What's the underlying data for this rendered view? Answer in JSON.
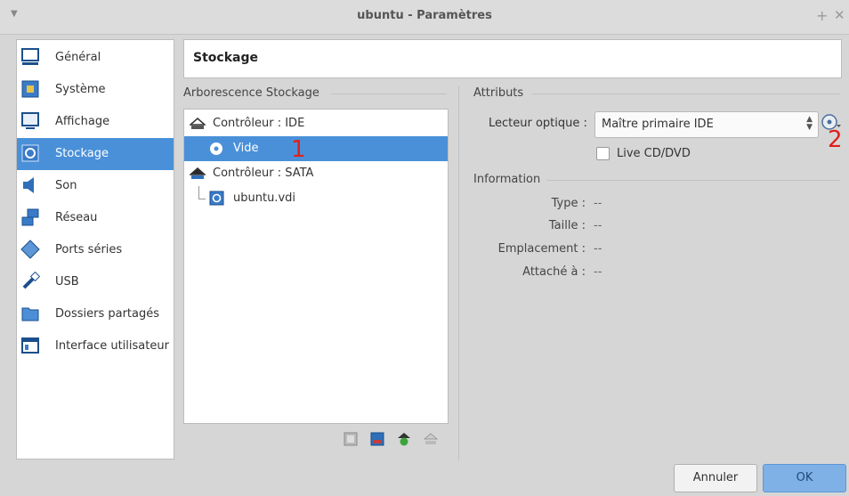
{
  "window": {
    "title": "ubuntu - Paramètres"
  },
  "sidebar": {
    "items": [
      {
        "label": "Général",
        "icon": "monitor-icon"
      },
      {
        "label": "Système",
        "icon": "chip-icon"
      },
      {
        "label": "Affichage",
        "icon": "display-icon"
      },
      {
        "label": "Stockage",
        "icon": "storage-icon",
        "selected": true
      },
      {
        "label": "Son",
        "icon": "speaker-icon"
      },
      {
        "label": "Réseau",
        "icon": "network-icon"
      },
      {
        "label": "Ports séries",
        "icon": "serial-port-icon"
      },
      {
        "label": "USB",
        "icon": "usb-icon"
      },
      {
        "label": "Dossiers partagés",
        "icon": "folder-icon"
      },
      {
        "label": "Interface utilisateur",
        "icon": "ui-window-icon"
      }
    ]
  },
  "header": {
    "title": "Stockage"
  },
  "tree": {
    "group_label": "Arborescence Stockage",
    "items": [
      {
        "label": "Contrôleur : IDE",
        "type": "controller"
      },
      {
        "label": "Vide",
        "type": "optical",
        "selected": true
      },
      {
        "label": "Contrôleur : SATA",
        "type": "controller"
      },
      {
        "label": "ubuntu.vdi",
        "type": "disk"
      }
    ],
    "annotation_1": "1"
  },
  "attributes": {
    "group_label": "Attributs",
    "optical_drive_label": "Lecteur optique :",
    "optical_drive_value": "Maître primaire IDE",
    "live_cd_label": "Live CD/DVD",
    "live_cd_checked": false,
    "annotation_2": "2"
  },
  "information": {
    "group_label": "Information",
    "rows": [
      {
        "label": "Type :",
        "value": "--"
      },
      {
        "label": "Taille :",
        "value": "--"
      },
      {
        "label": "Emplacement :",
        "value": "--"
      },
      {
        "label": "Attaché à :",
        "value": "--"
      }
    ]
  },
  "buttons": {
    "cancel": "Annuler",
    "ok": "OK"
  },
  "colors": {
    "selection": "#4a90d9",
    "annotation": "#e0201b"
  }
}
